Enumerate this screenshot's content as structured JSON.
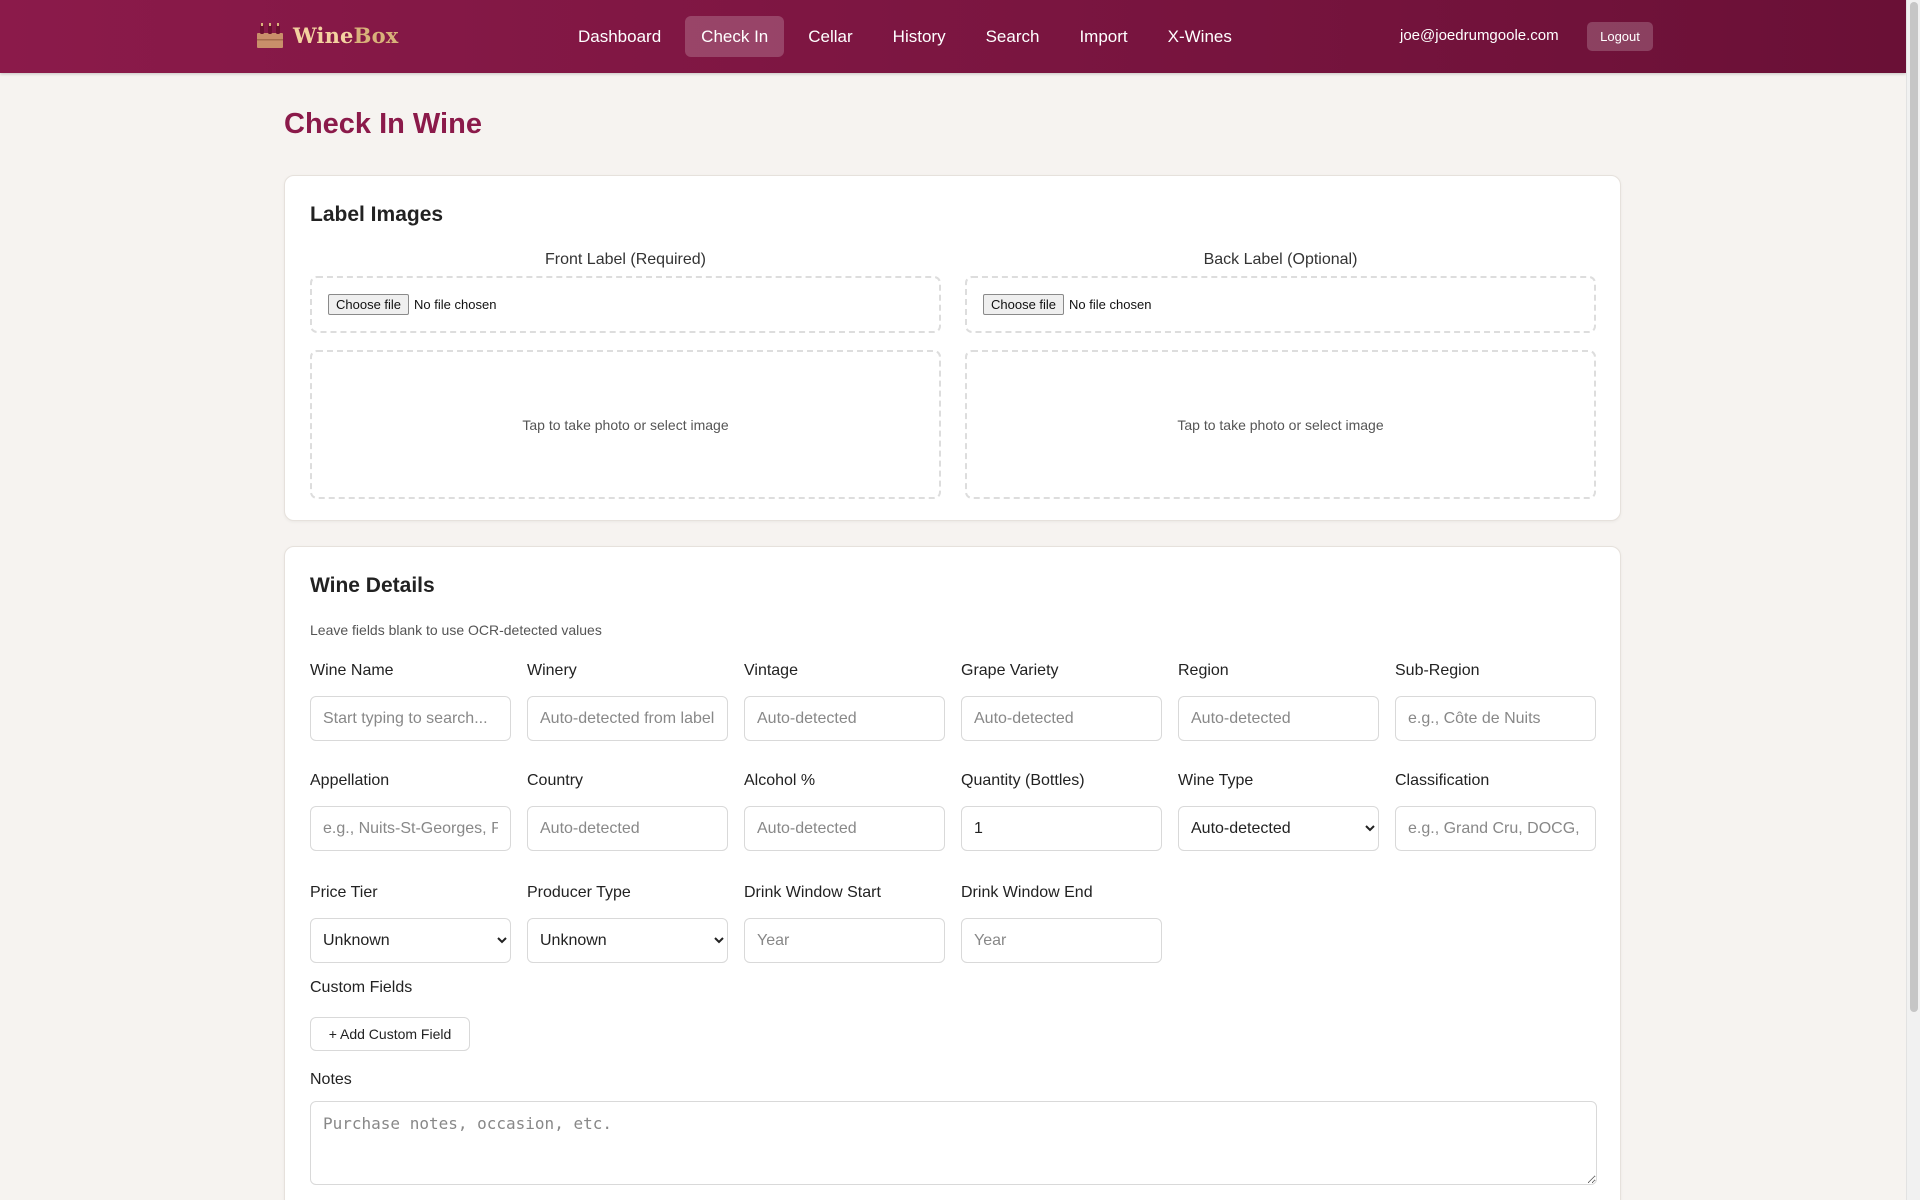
{
  "brand": {
    "name_part1": "Wine",
    "name_part2": "Box",
    "icon": "wine-rack-icon"
  },
  "nav": {
    "links": [
      {
        "label": "Dashboard",
        "active": false
      },
      {
        "label": "Check In",
        "active": true
      },
      {
        "label": "Cellar",
        "active": false
      },
      {
        "label": "History",
        "active": false
      },
      {
        "label": "Search",
        "active": false
      },
      {
        "label": "Import",
        "active": false
      },
      {
        "label": "X-Wines",
        "active": false
      }
    ],
    "user_email": "joe@joedrumgoole.com",
    "logout_label": "Logout"
  },
  "page": {
    "title": "Check In Wine"
  },
  "label_images": {
    "title": "Label Images",
    "front": {
      "label": "Front Label (Required)",
      "choose_label": "Choose file",
      "no_file": "No file chosen",
      "photo_prompt": "Tap to take photo or select image"
    },
    "back": {
      "label": "Back Label (Optional)",
      "choose_label": "Choose file",
      "no_file": "No file chosen",
      "photo_prompt": "Tap to take photo or select image"
    }
  },
  "wine_details": {
    "title": "Wine Details",
    "hint": "Leave fields blank to use OCR-detected values",
    "fields": {
      "wine_name": {
        "label": "Wine Name",
        "placeholder": "Start typing to search..."
      },
      "winery": {
        "label": "Winery",
        "placeholder": "Auto-detected from label"
      },
      "vintage": {
        "label": "Vintage",
        "placeholder": "Auto-detected"
      },
      "grape_variety": {
        "label": "Grape Variety",
        "placeholder": "Auto-detected"
      },
      "region": {
        "label": "Region",
        "placeholder": "Auto-detected"
      },
      "sub_region": {
        "label": "Sub-Region",
        "placeholder": "e.g., Côte de Nuits"
      },
      "appellation": {
        "label": "Appellation",
        "placeholder": "e.g., Nuits-St-Georges, Pauillac"
      },
      "country": {
        "label": "Country",
        "placeholder": "Auto-detected"
      },
      "alcohol": {
        "label": "Alcohol %",
        "placeholder": "Auto-detected"
      },
      "quantity": {
        "label": "Quantity (Bottles)",
        "value": "1"
      },
      "wine_type": {
        "label": "Wine Type",
        "selected": "Auto-detected"
      },
      "classification": {
        "label": "Classification",
        "placeholder": "e.g., Grand Cru, DOCG, etc."
      },
      "price_tier": {
        "label": "Price Tier",
        "selected": "Unknown"
      },
      "producer_type": {
        "label": "Producer Type",
        "selected": "Unknown"
      },
      "drink_window_start": {
        "label": "Drink Window Start",
        "placeholder": "Year"
      },
      "drink_window_end": {
        "label": "Drink Window End",
        "placeholder": "Year"
      }
    },
    "custom_fields": {
      "label": "Custom Fields",
      "add_button": "+ Add Custom Field"
    },
    "notes": {
      "label": "Notes",
      "placeholder": "Purchase notes, occasion, etc."
    }
  }
}
